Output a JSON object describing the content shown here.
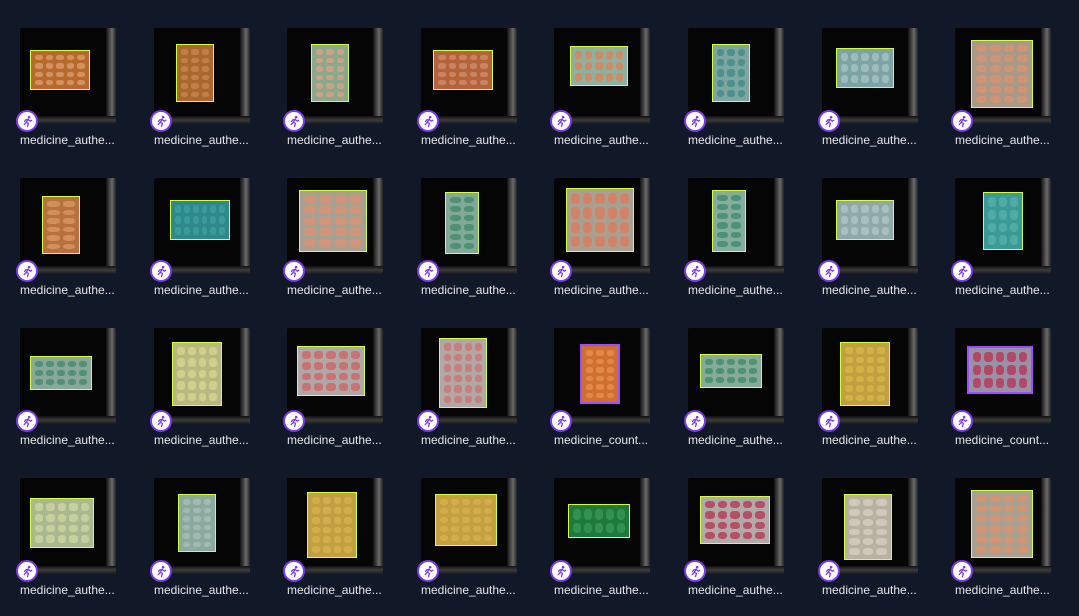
{
  "gallery": {
    "items": [
      {
        "name": "medicine_authe...",
        "pack": {
          "color": "#b86a2e",
          "tablet": "#d8a070",
          "rows": 4,
          "cols": 5
        },
        "border": "lime"
      },
      {
        "name": "medicine_authe...",
        "pack": {
          "color": "#a8682e",
          "tablet": "#c88850",
          "rows": 6,
          "cols": 3
        },
        "border": "lime"
      },
      {
        "name": "medicine_authe...",
        "pack": {
          "color": "#8aa88c",
          "tablet": "#e0a080",
          "rows": 6,
          "cols": 3
        },
        "border": "lime"
      },
      {
        "name": "medicine_authe...",
        "pack": {
          "color": "#b5633a",
          "tablet": "#d09070",
          "rows": 4,
          "cols": 5
        },
        "border": "lime"
      },
      {
        "name": "medicine_authe...",
        "pack": {
          "color": "#8fb0a0",
          "tablet": "#e08050",
          "rows": 3,
          "cols": 5
        },
        "border": "lime"
      },
      {
        "name": "medicine_authe...",
        "pack": {
          "color": "#7ea6a0",
          "tablet": "#3c8a88",
          "rows": 5,
          "cols": 3
        },
        "border": "lime"
      },
      {
        "name": "medicine_authe...",
        "pack": {
          "color": "#7ca4a4",
          "tablet": "#a8c4c4",
          "rows": 3,
          "cols": 5
        },
        "border": "lime"
      },
      {
        "name": "medicine_authe...",
        "pack": {
          "color": "#a89a8a",
          "tablet": "#e0906a",
          "rows": 6,
          "cols": 4
        },
        "border": "lime"
      },
      {
        "name": "medicine_authe...",
        "pack": {
          "color": "#b8703c",
          "tablet": "#d89a68",
          "rows": 6,
          "cols": 2
        },
        "border": "lime"
      },
      {
        "name": "medicine_authe...",
        "pack": {
          "color": "#2e8a8a",
          "tablet": "#3fa0a0",
          "rows": 3,
          "cols": 6
        },
        "border": "lime"
      },
      {
        "name": "medicine_authe...",
        "pack": {
          "color": "#a8a090",
          "tablet": "#e09070",
          "rows": 5,
          "cols": 4
        },
        "border": "lime"
      },
      {
        "name": "medicine_authe...",
        "pack": {
          "color": "#84a898",
          "tablet": "#3c8a6a",
          "rows": 6,
          "cols": 2
        },
        "border": "lime"
      },
      {
        "name": "medicine_authe...",
        "pack": {
          "color": "#a8a090",
          "tablet": "#e07a5a",
          "rows": 4,
          "cols": 5
        },
        "border": "lime"
      },
      {
        "name": "medicine_authe...",
        "pack": {
          "color": "#86aca0",
          "tablet": "#3a8a6a",
          "rows": 6,
          "cols": 2
        },
        "border": "lime"
      },
      {
        "name": "medicine_authe...",
        "pack": {
          "color": "#90a8a8",
          "tablet": "#b0c8c8",
          "rows": 3,
          "cols": 5
        },
        "border": "lime"
      },
      {
        "name": "medicine_authe...",
        "pack": {
          "color": "#3a9a98",
          "tablet": "#58b0ac",
          "rows": 4,
          "cols": 3
        },
        "border": "lime"
      },
      {
        "name": "medicine_authe...",
        "pack": {
          "color": "#8aa89a",
          "tablet": "#3c8a6c",
          "rows": 3,
          "cols": 5
        },
        "border": "lime"
      },
      {
        "name": "medicine_authe...",
        "pack": {
          "color": "#b8b880",
          "tablet": "#d8d890",
          "rows": 5,
          "cols": 4
        },
        "border": "lime"
      },
      {
        "name": "medicine_authe...",
        "pack": {
          "color": "#b0a8a8",
          "tablet": "#d06060",
          "rows": 4,
          "cols": 5
        },
        "border": "lime"
      },
      {
        "name": "medicine_authe...",
        "pack": {
          "color": "#b0a8a4",
          "tablet": "#d07070",
          "rows": 6,
          "cols": 4
        },
        "border": "lime"
      },
      {
        "name": "medicine_count...",
        "pack": {
          "color": "#d07030",
          "tablet": "#e89050",
          "rows": 6,
          "cols": 3
        },
        "border": "purple"
      },
      {
        "name": "medicine_authe...",
        "pack": {
          "color": "#88aa98",
          "tablet": "#3a8a6a",
          "rows": 3,
          "cols": 5
        },
        "border": "lime"
      },
      {
        "name": "medicine_authe...",
        "pack": {
          "color": "#c0a040",
          "tablet": "#d8b848",
          "rows": 6,
          "cols": 4
        },
        "border": "lime"
      },
      {
        "name": "medicine_count...",
        "pack": {
          "color": "#9a90a8",
          "tablet": "#b83050",
          "rows": 3,
          "cols": 5
        },
        "border": "purple"
      },
      {
        "name": "medicine_authe...",
        "pack": {
          "color": "#aab890",
          "tablet": "#d0d8a0",
          "rows": 4,
          "cols": 5
        },
        "border": "lime"
      },
      {
        "name": "medicine_authe...",
        "pack": {
          "color": "#8aaaa0",
          "tablet": "#a8c0b8",
          "rows": 6,
          "cols": 3
        },
        "border": "lime"
      },
      {
        "name": "medicine_authe...",
        "pack": {
          "color": "#c0a040",
          "tablet": "#d8b450",
          "rows": 6,
          "cols": 4
        },
        "border": "lime"
      },
      {
        "name": "medicine_authe...",
        "pack": {
          "color": "#c4a040",
          "tablet": "#d8b050",
          "rows": 5,
          "cols": 5
        },
        "border": "lime"
      },
      {
        "name": "medicine_authe...",
        "pack": {
          "color": "#1e7a3a",
          "tablet": "#3a9a58",
          "rows": 2,
          "cols": 5
        },
        "border": "lime"
      },
      {
        "name": "medicine_authe...",
        "pack": {
          "color": "#b0aaa8",
          "tablet": "#b83050",
          "rows": 4,
          "cols": 5
        },
        "border": "lime"
      },
      {
        "name": "medicine_authe...",
        "pack": {
          "color": "#b8b0a0",
          "tablet": "#d8d0c0",
          "rows": 6,
          "cols": 3
        },
        "border": "lime"
      },
      {
        "name": "medicine_authe...",
        "pack": {
          "color": "#a8a090",
          "tablet": "#e0906a",
          "rows": 6,
          "cols": 4
        },
        "border": "lime"
      }
    ],
    "badge_icon": "running-person-icon"
  }
}
